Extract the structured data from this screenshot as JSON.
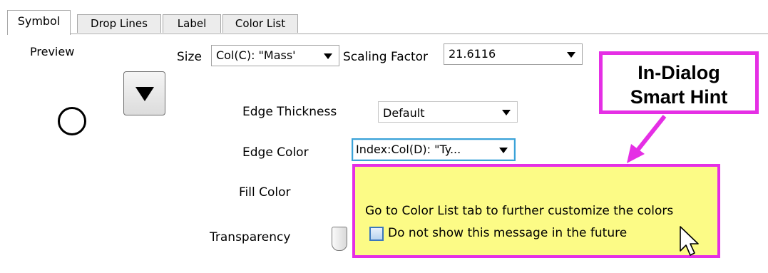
{
  "tabs": [
    {
      "label": "Symbol",
      "active": true
    },
    {
      "label": "Drop Lines",
      "active": false
    },
    {
      "label": "Label",
      "active": false
    },
    {
      "label": "Color List",
      "active": false
    }
  ],
  "preview": {
    "label": "Preview"
  },
  "size": {
    "label": "Size",
    "value": "Col(C): \"Mass'"
  },
  "scaling": {
    "label": "Scaling Factor",
    "value": "21.6116"
  },
  "edge_thickness": {
    "label": "Edge Thickness",
    "value": "Default"
  },
  "edge_color": {
    "label": "Edge Color",
    "value": "Index:Col(D): \"Ty..."
  },
  "fill_color": {
    "label": "Fill Color"
  },
  "transparency": {
    "label": "Transparency"
  },
  "hint": {
    "message": "Go to Color List tab to further customize the colors",
    "checkbox_label": "Do not show this message in the future",
    "checkbox_checked": false,
    "bg_color": "#fcfb86",
    "border_color": "#e52fe5"
  },
  "callout": {
    "line1": "In-Dialog",
    "line2": "Smart Hint",
    "color": "#e52fe5"
  }
}
